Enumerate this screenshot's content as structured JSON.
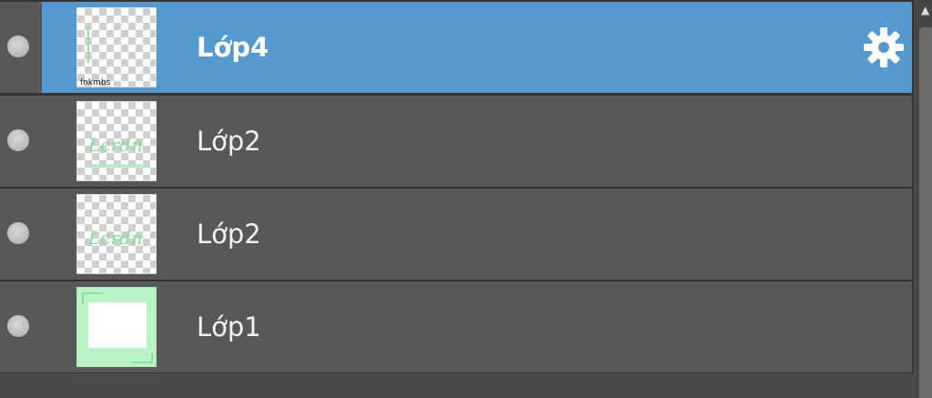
{
  "layers_panel": {
    "layers": [
      {
        "name": "Lớp4",
        "selected": true,
        "visible": true,
        "thumbnail": "checker-with-text",
        "thumb_caption": "fnkmbs"
      },
      {
        "name": "Lớp2",
        "selected": false,
        "visible": true,
        "thumbnail": "checker-green-script",
        "thumb_caption": "Lcrdn"
      },
      {
        "name": "Lớp2",
        "selected": false,
        "visible": true,
        "thumbnail": "checker-green-script",
        "thumb_caption": "Lcrdn"
      },
      {
        "name": "Lớp1",
        "selected": false,
        "visible": true,
        "thumbnail": "green-frame-white",
        "thumb_caption": ""
      }
    ],
    "settings_icon": "gear-icon",
    "visibility_icon": "eye-dot-icon",
    "colors": {
      "panel_bg": "#585858",
      "selected_bg": "#5499cf",
      "text": "#f2f2f2",
      "thumb_green": "#b9f2c6"
    }
  }
}
